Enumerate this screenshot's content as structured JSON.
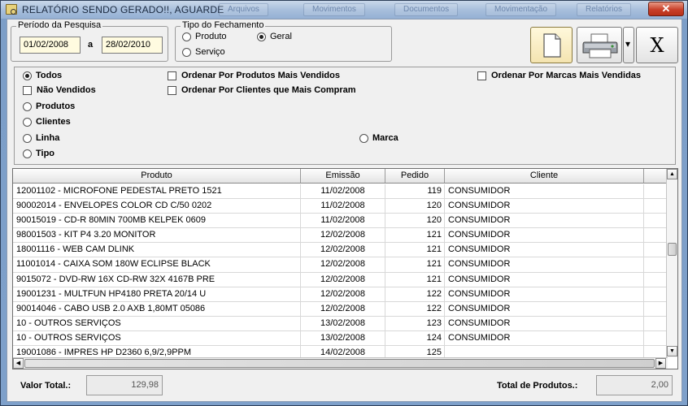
{
  "window": {
    "title": "RELATÓRIO SENDO GERADO!!, AGUARDE",
    "background_tabs": [
      "Arquivos",
      "Movimentos",
      "Documentos",
      "Movimentação",
      "Relatórios"
    ],
    "close_label": "✕"
  },
  "periodo": {
    "legend": "Período da Pesquisa",
    "start": "01/02/2008",
    "separator": "a",
    "end": "28/02/2010"
  },
  "fechamento": {
    "legend": "Tipo do Fechamento",
    "options": [
      {
        "label": "Produto",
        "selected": false
      },
      {
        "label": "Geral",
        "selected": true
      },
      {
        "label": "Serviço",
        "selected": false
      }
    ]
  },
  "toolbar": {
    "document_icon": "document-icon",
    "printer_icon": "printer-icon",
    "dropdown_glyph": "▾",
    "exit_label": "X"
  },
  "filters": {
    "radios": [
      {
        "label": "Todos",
        "selected": true
      },
      {
        "label": "Produtos",
        "selected": false
      },
      {
        "label": "Clientes",
        "selected": false
      },
      {
        "label": "Linha",
        "selected": false
      },
      {
        "label": "Tipo",
        "selected": false
      },
      {
        "label": "Marca",
        "selected": false
      }
    ],
    "checks": [
      {
        "label": "Não Vendidos",
        "checked": false
      },
      {
        "label": "Ordenar Por Produtos Mais Vendidos",
        "checked": false
      },
      {
        "label": "Ordenar Por Clientes que Mais Compram",
        "checked": false
      },
      {
        "label": "Ordenar Por Marcas Mais Vendidas",
        "checked": false
      }
    ]
  },
  "table": {
    "columns": [
      "Produto",
      "Emissão",
      "Pedido",
      "Cliente",
      ""
    ],
    "rows": [
      [
        "12001102 - MICROFONE PEDESTAL PRETO  1521",
        "11/02/2008",
        "119",
        "CONSUMIDOR"
      ],
      [
        "90002014 - ENVELOPES COLOR CD C/50   0202",
        "11/02/2008",
        "120",
        "CONSUMIDOR"
      ],
      [
        "90015019 - CD-R 80MIN 700MB KELPEK   0609",
        "11/02/2008",
        "120",
        "CONSUMIDOR"
      ],
      [
        "98001503 - KIT P4 3.20 MONITOR",
        "12/02/2008",
        "121",
        "CONSUMIDOR"
      ],
      [
        "18001116 - WEB CAM DLINK",
        "12/02/2008",
        "121",
        "CONSUMIDOR"
      ],
      [
        "11001014 - CAIXA SOM 180W ECLIPSE BLACK",
        "12/02/2008",
        "121",
        " CONSUMIDOR"
      ],
      [
        "9015072 - DVD-RW 16X CD-RW 32X 4167B PRE",
        "12/02/2008",
        "121",
        " CONSUMIDOR"
      ],
      [
        "19001231 - MULTFUN HP4180 PRETA   20/14 U",
        "12/02/2008",
        "122",
        " CONSUMIDOR"
      ],
      [
        "90014046 - CABO USB 2.0 AXB  1,80MT 05086",
        "12/02/2008",
        "122",
        " CONSUMIDOR"
      ],
      [
        "10 - OUTROS SERVIÇOS",
        "13/02/2008",
        "123",
        "CONSUMIDOR"
      ],
      [
        "10 - OUTROS SERVIÇOS",
        "13/02/2008",
        "124",
        "CONSUMIDOR"
      ],
      [
        "19001086 - IMPRES  HP D2360 6,9/2,9PPM",
        "14/02/2008",
        "125",
        ""
      ]
    ]
  },
  "footer": {
    "valor_label": "Valor Total.:",
    "valor_value": "129,98",
    "total_label": "Total de Produtos.:",
    "total_value": "2,00"
  }
}
